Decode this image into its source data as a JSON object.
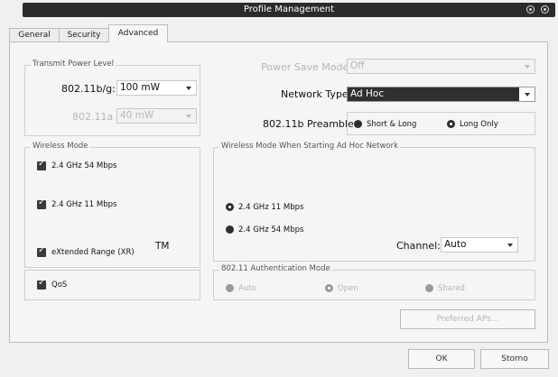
{
  "window": {
    "title": "Profile Management"
  },
  "tabs": [
    {
      "label": "General"
    },
    {
      "label": "Security"
    },
    {
      "label": "Advanced"
    }
  ],
  "transmit_power": {
    "legend": "Transmit Power Level",
    "b_g_label": "802.11b/g:",
    "b_g_value": "100 mW",
    "a_label": "802.11a",
    "a_value": "40 mW"
  },
  "power_save": {
    "label": "Power Save Mode:",
    "value": "Off"
  },
  "network_type": {
    "label": "Network Type:",
    "value": "Ad Hoc"
  },
  "preamble": {
    "label": "802.11b Preamble:",
    "options": [
      "Short & Long",
      "Long Only"
    ],
    "selected": "Long Only"
  },
  "wireless_mode": {
    "legend": "Wireless Mode",
    "items": [
      {
        "label": "2.4 GHz 54 Mbps",
        "checked": true
      },
      {
        "label": "2.4 GHz 11 Mbps",
        "checked": true
      },
      {
        "label": "eXtended Range (XR)",
        "checked": true
      },
      {
        "label": "QoS",
        "checked": true
      }
    ],
    "tm": "TM"
  },
  "adhoc_mode": {
    "legend": "Wireless Mode When Starting Ad Hoc Network",
    "options": [
      "2.4 GHz 11 Mbps",
      "2.4 GHz 54 Mbps"
    ],
    "selected": "2.4 GHz 11 Mbps",
    "channel_label": "Channel:",
    "channel_value": "Auto"
  },
  "auth_mode": {
    "legend": "802.11 Authentication Mode",
    "options": [
      "Auto",
      "Open",
      "Shared"
    ],
    "selected": "Open"
  },
  "buttons": {
    "preferred_aps": "Preferred APs...",
    "ok": "OK",
    "cancel": "Storno"
  }
}
